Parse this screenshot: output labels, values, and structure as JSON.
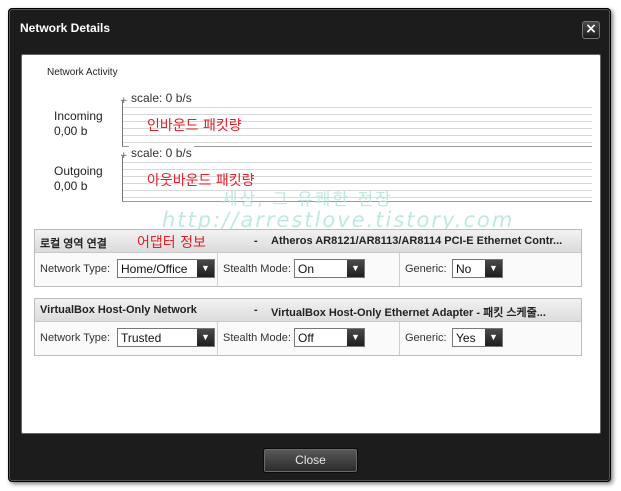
{
  "window": {
    "title": "Network Details",
    "close_icon": "×"
  },
  "activity": {
    "label": "Network Activity",
    "incoming": {
      "name": "Incoming",
      "value": "0,00 b",
      "scale": "scale: 0 b/s",
      "annotation": "인바운드 패킷량"
    },
    "outgoing": {
      "name": "Outgoing",
      "value": "0,00 b",
      "scale": "scale: 0 b/s",
      "annotation": "아웃바운드 패킷량"
    }
  },
  "watermark": {
    "line1": "세상, 그 유쾌한 전장",
    "line2": "http://arrestlove.tistory.com"
  },
  "adapters": [
    {
      "name": "로컬 영역 연결",
      "annotation": "어댑터 정보",
      "dash": "-",
      "adapter": "Atheros AR8121/AR8113/AR8114 PCI-E Ethernet Contr...",
      "network_type_label": "Network Type:",
      "network_type": "Home/Office",
      "stealth_label": "Stealth Mode:",
      "stealth": "On",
      "generic_label": "Generic:",
      "generic": "No"
    },
    {
      "name": "VirtualBox Host-Only Network",
      "annotation": "",
      "dash": "-",
      "adapter": "VirtualBox Host-Only Ethernet Adapter - 패킷 스케줄...",
      "network_type_label": "Network Type:",
      "network_type": "Trusted",
      "stealth_label": "Stealth Mode:",
      "stealth": "Off",
      "generic_label": "Generic:",
      "generic": "Yes"
    }
  ],
  "footer": {
    "close_label": "Close"
  }
}
